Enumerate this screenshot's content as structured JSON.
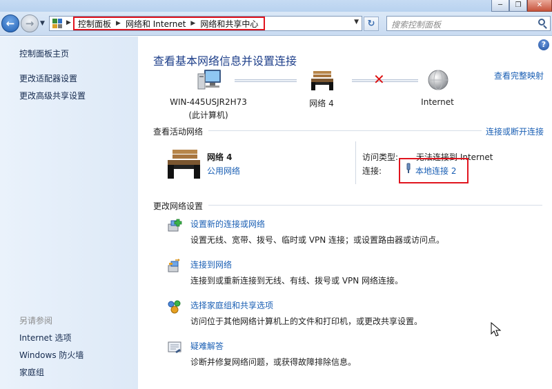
{
  "window": {
    "min_glyph": "─",
    "max_glyph": "❐",
    "close_glyph": "✕"
  },
  "address": {
    "breadcrumbs": [
      "控制面板",
      "网络和 Internet",
      "网络和共享中心"
    ],
    "search_placeholder": "搜索控制面板"
  },
  "sidebar": {
    "items": [
      {
        "label": "控制面板主页"
      },
      {
        "label": "更改适配器设置"
      },
      {
        "label": "更改高级共享设置"
      }
    ],
    "see_also_heading": "另请参阅",
    "see_also": [
      {
        "label": "Internet 选项"
      },
      {
        "label": "Windows 防火墙"
      },
      {
        "label": "家庭组"
      }
    ]
  },
  "main": {
    "title": "查看基本网络信息并设置连接",
    "full_map_link": "查看完整映射",
    "map": {
      "computer_name": "WIN-445USJR2H73",
      "computer_sub": "(此计算机)",
      "network_name": "网络  4",
      "internet_label": "Internet"
    },
    "active_networks_label": "查看活动网络",
    "connect_disconnect_link": "连接或断开连接",
    "active_network": {
      "name": "网络  4",
      "type_link": "公用网络",
      "access_type_label": "访问类型:",
      "access_type_value": "无法连接到 Internet",
      "connections_label": "连接:",
      "connection_link": "本地连接 2"
    },
    "change_settings_label": "更改网络设置",
    "tasks": [
      {
        "icon": "new-connection-icon",
        "title": "设置新的连接或网络",
        "desc": "设置无线、宽带、拨号、临时或 VPN 连接；或设置路由器或访问点。"
      },
      {
        "icon": "connect-to-network-icon",
        "title": "连接到网络",
        "desc": "连接到或重新连接到无线、有线、拨号或 VPN 网络连接。"
      },
      {
        "icon": "homegroup-sharing-icon",
        "title": "选择家庭组和共享选项",
        "desc": "访问位于其他网络计算机上的文件和打印机，或更改共享设置。"
      },
      {
        "icon": "troubleshoot-icon",
        "title": "疑难解答",
        "desc": "诊断并修复网络问题，或获得故障排除信息。"
      }
    ]
  },
  "colors": {
    "link": "#1a5fb4",
    "highlight_box": "#e0141e",
    "title": "#1e3f8a"
  }
}
